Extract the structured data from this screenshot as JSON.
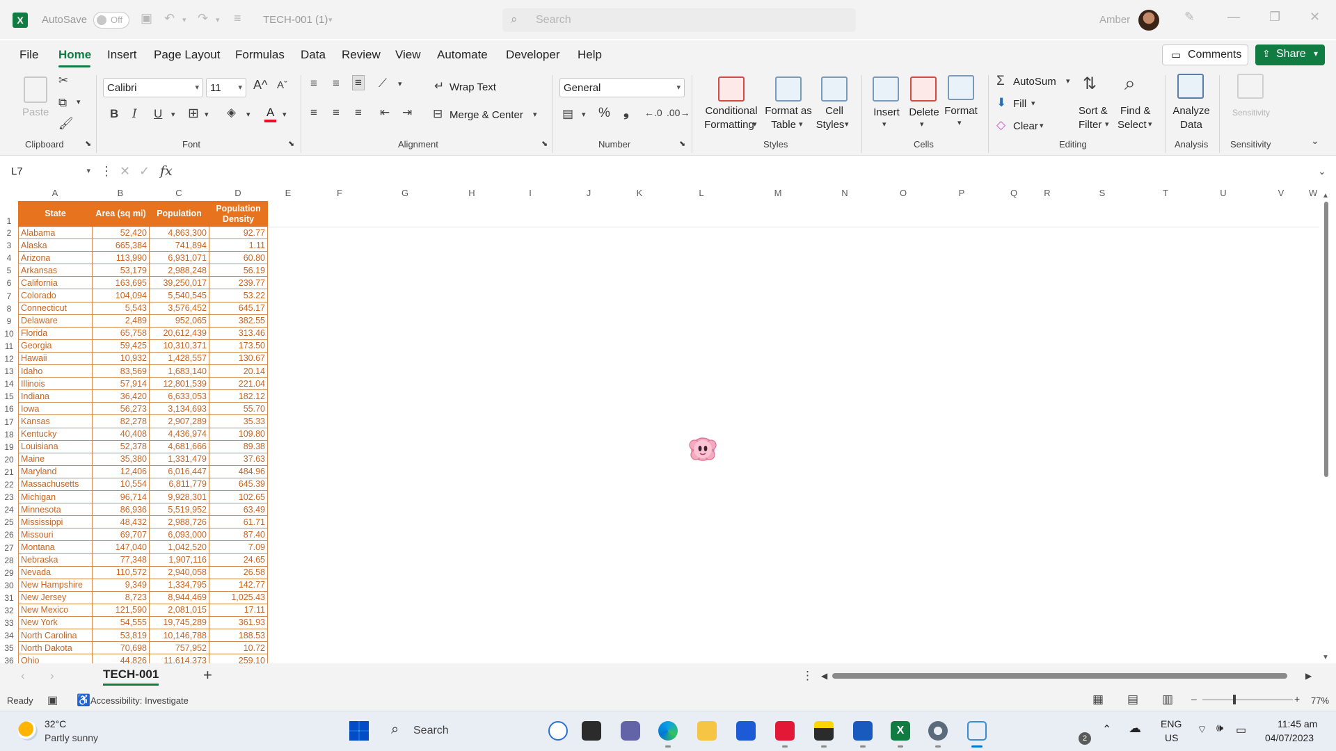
{
  "app": {
    "autosave_label": "AutoSave",
    "autosave_state": "Off",
    "file_name": "TECH-001 (1)",
    "search_placeholder": "Search",
    "user_name": "Amber"
  },
  "menu": {
    "tabs": [
      "File",
      "Home",
      "Insert",
      "Page Layout",
      "Formulas",
      "Data",
      "Review",
      "View",
      "Automate",
      "Developer",
      "Help"
    ],
    "active": "Home",
    "comments_label": "Comments",
    "share_label": "Share"
  },
  "ribbon": {
    "clipboard": {
      "paste": "Paste",
      "group": "Clipboard"
    },
    "font": {
      "name": "Calibri",
      "size": "11",
      "group": "Font",
      "bold": "B",
      "italic": "I",
      "underline": "U",
      "grow": "A^",
      "shrink": "Aˇ",
      "font_color": "A"
    },
    "alignment": {
      "wrap_text": "Wrap Text",
      "merge_center": "Merge & Center",
      "group": "Alignment"
    },
    "number": {
      "format": "General",
      "group": "Number"
    },
    "styles": {
      "conditional_1": "Conditional",
      "conditional_2": "Formatting",
      "format_table_1": "Format as",
      "format_table_2": "Table",
      "cell_styles_1": "Cell",
      "cell_styles_2": "Styles",
      "group": "Styles"
    },
    "cells": {
      "insert": "Insert",
      "delete": "Delete",
      "format": "Format",
      "group": "Cells"
    },
    "editing": {
      "autosum": "AutoSum",
      "fill": "Fill",
      "clear": "Clear",
      "sort_1": "Sort &",
      "sort_2": "Filter",
      "find_1": "Find &",
      "find_2": "Select",
      "group": "Editing"
    },
    "analysis": {
      "analyze_1": "Analyze",
      "analyze_2": "Data",
      "group": "Analysis"
    },
    "sensitivity": {
      "label": "Sensitivity",
      "group": "Sensitivity"
    }
  },
  "formula_bar": {
    "name_box": "L7",
    "fx": "fx",
    "value": ""
  },
  "columns": [
    "A",
    "B",
    "C",
    "D",
    "E",
    "F",
    "G",
    "H",
    "I",
    "J",
    "K",
    "L",
    "M",
    "N",
    "O",
    "P",
    "Q",
    "R",
    "S",
    "T",
    "U",
    "V",
    "W"
  ],
  "table": {
    "headers": [
      "State",
      "Area (sq mi)",
      "Population",
      "Population Density"
    ],
    "rows": [
      [
        "Alabama",
        "52,420",
        "4,863,300",
        "92.77"
      ],
      [
        "Alaska",
        "665,384",
        "741,894",
        "1.11"
      ],
      [
        "Arizona",
        "113,990",
        "6,931,071",
        "60.80"
      ],
      [
        "Arkansas",
        "53,179",
        "2,988,248",
        "56.19"
      ],
      [
        "California",
        "163,695",
        "39,250,017",
        "239.77"
      ],
      [
        "Colorado",
        "104,094",
        "5,540,545",
        "53.22"
      ],
      [
        "Connecticut",
        "5,543",
        "3,576,452",
        "645.17"
      ],
      [
        "Delaware",
        "2,489",
        "952,065",
        "382.55"
      ],
      [
        "Florida",
        "65,758",
        "20,612,439",
        "313.46"
      ],
      [
        "Georgia",
        "59,425",
        "10,310,371",
        "173.50"
      ],
      [
        "Hawaii",
        "10,932",
        "1,428,557",
        "130.67"
      ],
      [
        "Idaho",
        "83,569",
        "1,683,140",
        "20.14"
      ],
      [
        "Illinois",
        "57,914",
        "12,801,539",
        "221.04"
      ],
      [
        "Indiana",
        "36,420",
        "6,633,053",
        "182.12"
      ],
      [
        "Iowa",
        "56,273",
        "3,134,693",
        "55.70"
      ],
      [
        "Kansas",
        "82,278",
        "2,907,289",
        "35.33"
      ],
      [
        "Kentucky",
        "40,408",
        "4,436,974",
        "109.80"
      ],
      [
        "Louisiana",
        "52,378",
        "4,681,666",
        "89.38"
      ],
      [
        "Maine",
        "35,380",
        "1,331,479",
        "37.63"
      ],
      [
        "Maryland",
        "12,406",
        "6,016,447",
        "484.96"
      ],
      [
        "Massachusetts",
        "10,554",
        "6,811,779",
        "645.39"
      ],
      [
        "Michigan",
        "96,714",
        "9,928,301",
        "102.65"
      ],
      [
        "Minnesota",
        "86,936",
        "5,519,952",
        "63.49"
      ],
      [
        "Mississippi",
        "48,432",
        "2,988,726",
        "61.71"
      ],
      [
        "Missouri",
        "69,707",
        "6,093,000",
        "87.40"
      ],
      [
        "Montana",
        "147,040",
        "1,042,520",
        "7.09"
      ],
      [
        "Nebraska",
        "77,348",
        "1,907,116",
        "24.65"
      ],
      [
        "Nevada",
        "110,572",
        "2,940,058",
        "26.58"
      ],
      [
        "New Hampshire",
        "9,349",
        "1,334,795",
        "142.77"
      ],
      [
        "New Jersey",
        "8,723",
        "8,944,469",
        "1,025.43"
      ],
      [
        "New Mexico",
        "121,590",
        "2,081,015",
        "17.11"
      ],
      [
        "New York",
        "54,555",
        "19,745,289",
        "361.93"
      ],
      [
        "North Carolina",
        "53,819",
        "10,146,788",
        "188.53"
      ],
      [
        "North Dakota",
        "70,698",
        "757,952",
        "10.72"
      ],
      [
        "Ohio",
        "44,826",
        "11,614,373",
        "259.10"
      ]
    ]
  },
  "sheet": {
    "tab": "TECH-001",
    "add": "+"
  },
  "status": {
    "ready": "Ready",
    "accessibility": "Accessibility: Investigate",
    "zoom": "77%",
    "zoom_minus": "–",
    "zoom_plus": "+"
  },
  "taskbar": {
    "temp": "32°C",
    "weather": "Partly sunny",
    "search": "Search",
    "lang_1": "ENG",
    "lang_2": "US",
    "time": "11:45 am",
    "date": "04/07/2023",
    "badge": "2"
  }
}
